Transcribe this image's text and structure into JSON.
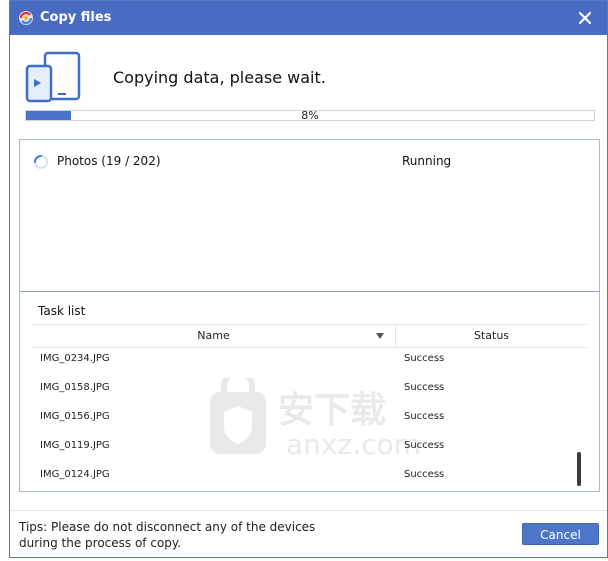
{
  "window": {
    "title": "Copy files",
    "colors": {
      "titlebar": "#4a6bc2",
      "accent": "#4a73c9",
      "button": "#4e76c8"
    }
  },
  "header": {
    "heading": "Copying data, please wait.",
    "progress_percent": 8,
    "progress_label": "8%"
  },
  "current_task": {
    "name": "Photos (19 / 202)",
    "status": "Running"
  },
  "task_list": {
    "label": "Task list",
    "columns": {
      "name": "Name",
      "status": "Status"
    },
    "rows": [
      {
        "name": "IMG_0234.JPG",
        "status": "Success"
      },
      {
        "name": "IMG_0158.JPG",
        "status": "Success"
      },
      {
        "name": "IMG_0156.JPG",
        "status": "Success"
      },
      {
        "name": "IMG_0119.JPG",
        "status": "Success"
      },
      {
        "name": "IMG_0124.JPG",
        "status": "Success"
      }
    ]
  },
  "footer": {
    "tips_line1": "Tips: Please do not disconnect any of the devices",
    "tips_line2": "during the process of copy.",
    "cancel_label": "Cancel"
  },
  "watermark": {
    "text_cn": "安下载",
    "text_en": "anxz.com"
  },
  "icons": [
    "app-icon",
    "close-icon",
    "device-icon",
    "spinner-icon",
    "sort-arrow-icon",
    "watermark-shield-icon"
  ]
}
